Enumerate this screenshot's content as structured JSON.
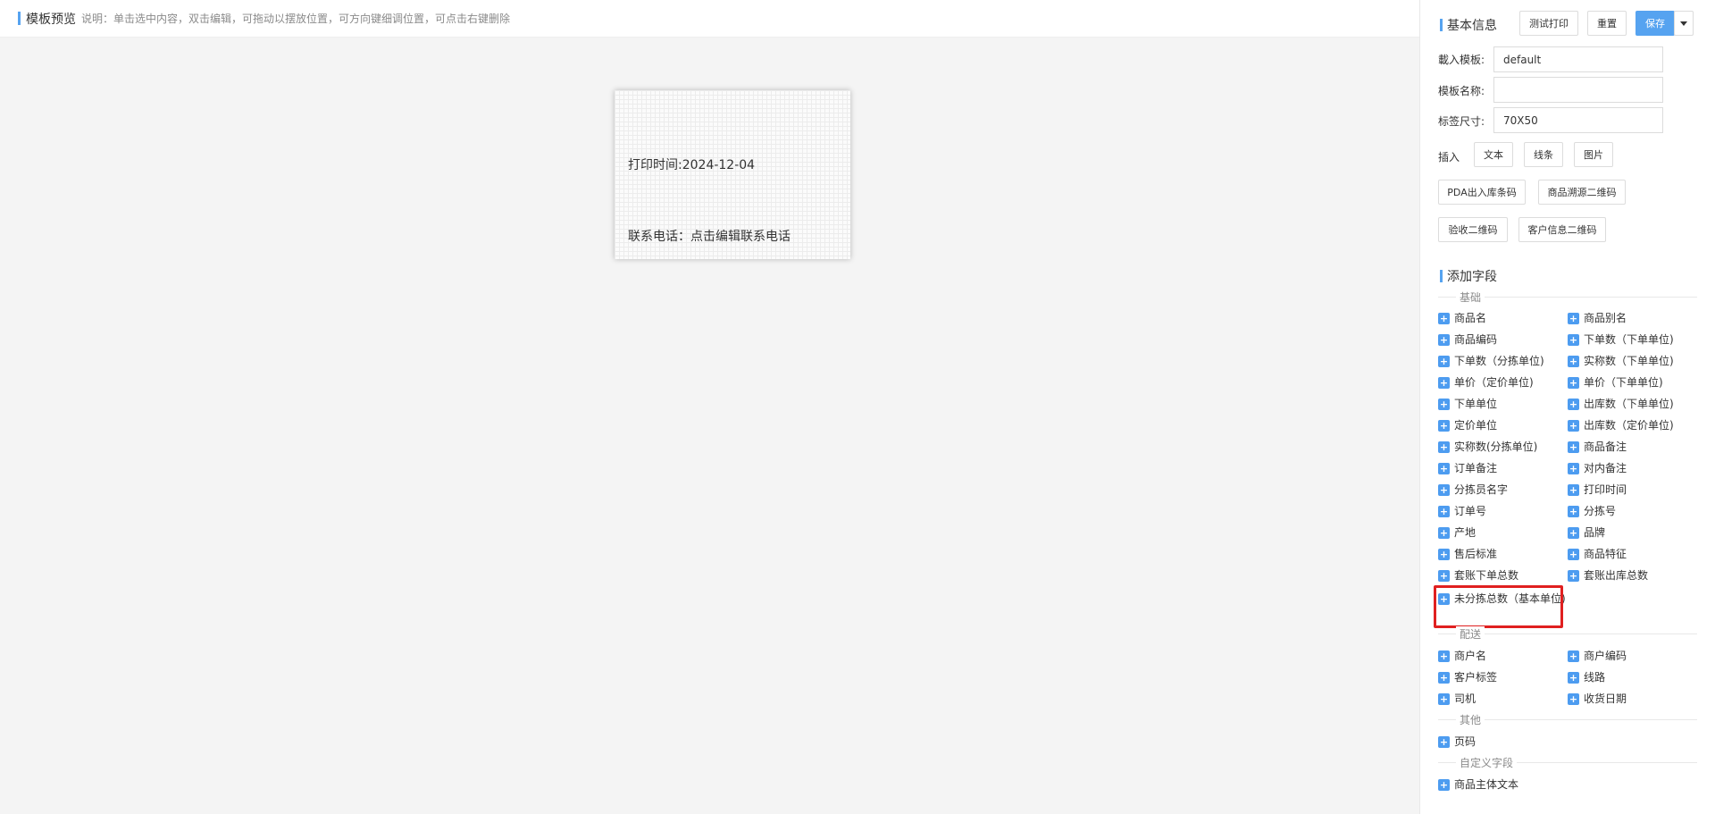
{
  "preview": {
    "title": "模板预览",
    "description": "说明：单击选中内容，双击编辑，可拖动以摆放位置，可方向键细调位置，可点击右键删除",
    "label": {
      "print_time": "打印时间:2024-12-04",
      "contact": "联系电话：点击编辑联系电话"
    }
  },
  "basic_info": {
    "title": "基本信息",
    "test_print": "测试打印",
    "reset": "重置",
    "save": "保存",
    "fields": {
      "load_template_label": "載入模板:",
      "load_template_value": "default",
      "template_name_label": "模板名称:",
      "template_name_value": "",
      "label_size_label": "标签尺寸:",
      "label_size_value": "70X50"
    },
    "insert_label": "插入",
    "insert_buttons": {
      "text": "文本",
      "line": "线条",
      "image": "图片",
      "pda_barcode": "PDA出入库条码",
      "trace_qr": "商品溯源二维码",
      "accept_qr": "验收二维码",
      "customer_qr": "客户信息二维码"
    }
  },
  "add_fields": {
    "title": "添加字段",
    "groups": {
      "basic": "基础",
      "delivery": "配送",
      "other": "其他",
      "custom": "自定义字段"
    },
    "basic_items": [
      "商品名",
      "商品别名",
      "商品编码",
      "下单数（下单单位)",
      "下单数（分拣单位)",
      "实称数（下单单位)",
      "单价（定价单位)",
      "单价（下单单位)",
      "下单单位",
      "出库数（下单单位)",
      "定价单位",
      "出库数（定价单位)",
      "实称数(分拣单位)",
      "商品备注",
      "订单备注",
      "对内备注",
      "分拣员名字",
      "打印时间",
      "订单号",
      "分拣号",
      "产地",
      "品牌",
      "售后标准",
      "商品特征",
      "套账下单总数",
      "套账出库总数",
      "未分拣总数（基本单位)"
    ],
    "delivery_items": [
      "商户名",
      "商户编码",
      "客户标签",
      "线路",
      "司机",
      "收货日期"
    ],
    "other_items": [
      "页码"
    ],
    "custom_items": [
      "商品主体文本"
    ]
  }
}
